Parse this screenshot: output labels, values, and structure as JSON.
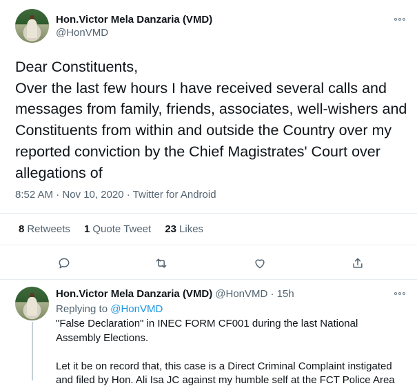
{
  "main_tweet": {
    "author_name": "Hon.Victor Mela Danzaria (VMD)",
    "author_handle": "@HonVMD",
    "text": "Dear Constituents,\nOver the last few hours I have received several calls and messages from family, friends, associates, well-wishers and Constituents from within and outside the Country over my reported conviction by the Chief Magistrates' Court over allegations of",
    "time": "8:52 AM · Nov 10, 2020 · ",
    "source": "Twitter for Android",
    "stats": {
      "retweets_count": "8",
      "retweets_label": "Retweets",
      "quotes_count": "1",
      "quotes_label": "Quote Tweet",
      "likes_count": "23",
      "likes_label": "Likes"
    },
    "actions": [
      "reply-icon",
      "retweet-icon",
      "like-icon",
      "share-icon"
    ]
  },
  "reply_tweet": {
    "author_name": "Hon.Victor Mela Danzaria (VMD)",
    "author_handle": "@HonVMD · 15h",
    "replying_prefix": "Replying to ",
    "replying_to": "@HonVMD",
    "text": "\"False Declaration\" in INEC FORM CF001 during the last National Assembly Elections.\n\nLet it be on record that, this case is a Direct Criminal Complaint instigated and filed by Hon. Ali Isa JC against my humble self at the FCT Police Area"
  },
  "colors": {
    "link": "#1b95e0",
    "muted": "#536471",
    "text": "#0f1419"
  }
}
